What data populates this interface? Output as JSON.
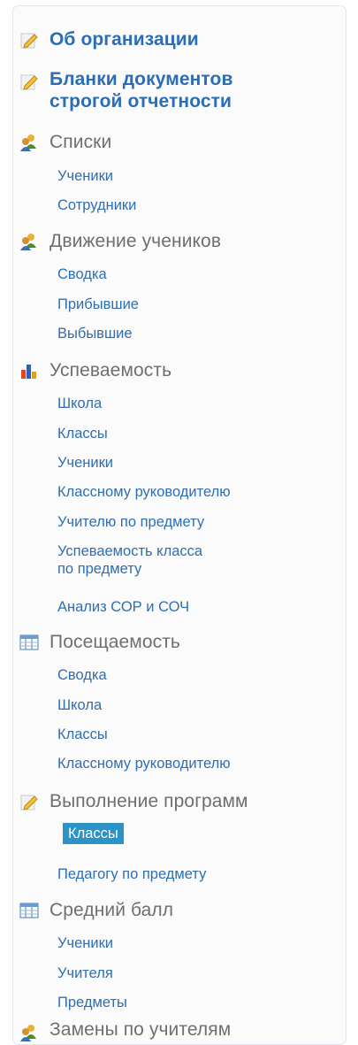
{
  "menu": {
    "about": "Об организации",
    "blanks_line1": "Бланки документов",
    "blanks_line2": "строгой отчетности",
    "lists": {
      "title": "Списки",
      "items": [
        "Ученики",
        "Сотрудники"
      ]
    },
    "movement": {
      "title": "Движение учеников",
      "items": [
        "Сводка",
        "Прибывшие",
        "Выбывшие"
      ]
    },
    "performance": {
      "title": "Успеваемость",
      "items": [
        "Школа",
        "Классы",
        "Ученики",
        "Классному руководителю",
        "Учителю по предмету",
        "Успеваемость класса",
        "по предмету",
        "Анализ СОР и СОЧ"
      ]
    },
    "attendance": {
      "title": "Посещаемость",
      "items": [
        "Сводка",
        "Школа",
        "Классы",
        "Классному руководителю"
      ]
    },
    "program": {
      "title": "Выполнение программ",
      "items": [
        "Классы",
        "Педагогу по предмету"
      ]
    },
    "average": {
      "title": "Средний балл",
      "items": [
        "Ученики",
        "Учителя",
        "Предметы"
      ]
    },
    "last_partial": "Замены по учителям"
  },
  "colors": {
    "link": "#2a6db8",
    "header_gray": "#6f6f6f",
    "active_bg": "#2b93c6"
  }
}
